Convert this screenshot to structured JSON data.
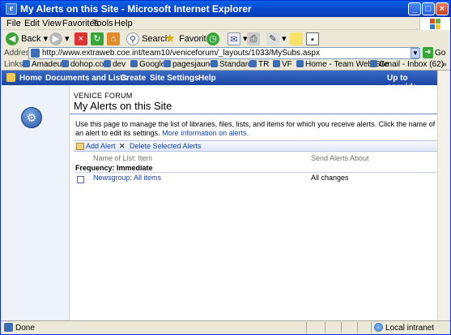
{
  "window": {
    "title": "My Alerts on this Site - Microsoft Internet Explorer"
  },
  "menu": [
    "File",
    "Edit",
    "View",
    "Favorites",
    "Tools",
    "Help"
  ],
  "toolbar": {
    "back": "Back",
    "search": "Search",
    "favorites": "Favorites"
  },
  "address": {
    "label": "Address",
    "url": "http://www.extraweb.coe.int/team10/veniceforum/_layouts/1033/MySubs.aspx",
    "go": "Go"
  },
  "links": {
    "label": "Links",
    "items": [
      "Amadeus",
      "dohop.com",
      "dev",
      "Google",
      "pagesjaunes",
      "Standard",
      "TR",
      "VF",
      "Home - Team Web Site",
      "Gmail - Inbox (62)"
    ]
  },
  "nav": {
    "items": [
      "Home",
      "Documents and Lists",
      "Create",
      "Site Settings",
      "Help"
    ],
    "up": "Up to coevide"
  },
  "site": {
    "name": "VENICE FORUM",
    "page_title": "My Alerts on this Site"
  },
  "description": {
    "text": "Use this page to manage the list of libraries, files, lists, and items for which you receive alerts. Click the name of an alert to edit its settings. ",
    "link": "More information on alerts."
  },
  "actions": {
    "add": "Add Alert",
    "delete": "Delete Selected Alerts"
  },
  "columns": {
    "name": "Name of List: Item",
    "send": "Send Alerts About"
  },
  "frequency": "Frequency: Immediate",
  "alerts": [
    {
      "name": "Newsgroup: All items",
      "send": "All changes"
    }
  ],
  "status": {
    "left": "Done",
    "zone": "Local intranet"
  }
}
